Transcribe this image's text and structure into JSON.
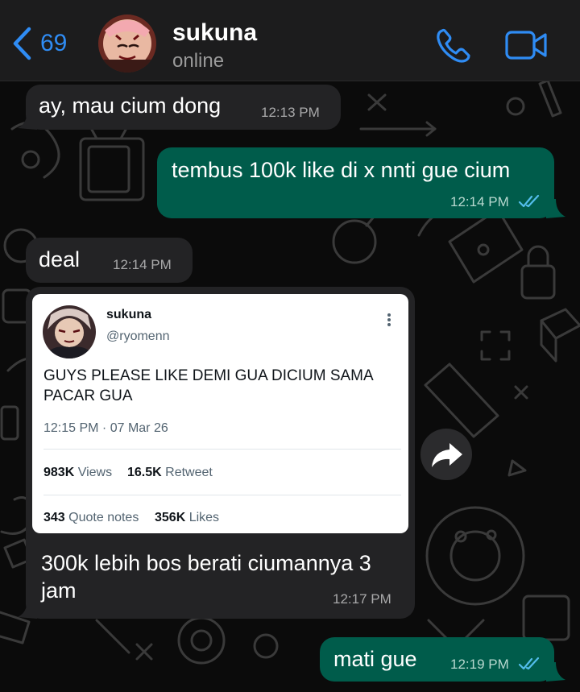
{
  "header": {
    "back_count": "69",
    "contact_name": "sukuna",
    "status": "online",
    "colors": {
      "accent": "#2f8cf4",
      "header_bg": "#1c1c1d"
    },
    "icons": [
      "chevron-left-icon",
      "phone-icon",
      "video-camera-icon"
    ]
  },
  "messages": [
    {
      "direction": "incoming",
      "text": "ay, mau cium dong",
      "time": "12:13 PM"
    },
    {
      "direction": "outgoing",
      "text": "tembus 100k like di x nnti gue cium",
      "time": "12:14 PM",
      "status": "read"
    },
    {
      "direction": "incoming",
      "text": "deal",
      "time": "12:14 PM"
    },
    {
      "direction": "incoming",
      "caption": [
        "300k lebih bos berati ciumannya 3",
        "jam"
      ],
      "time": "12:17 PM",
      "tweet": {
        "name": "sukuna",
        "handle": "@ryomenn",
        "text": "GUYS PLEASE LIKE DEMI GUA DICIUM SAMA PACAR GUA",
        "timestamp": "12:15 PM · 07 Mar 26",
        "views_count": "983K",
        "views_label": "Views",
        "retweet_count": "16.5K",
        "retweet_label": "Retweet",
        "quote_count": "343",
        "quote_label": "Quote notes",
        "likes_count": "356K",
        "likes_label": "Likes"
      }
    },
    {
      "direction": "outgoing",
      "text": "mati gue",
      "time": "12:19 PM",
      "status": "read"
    }
  ],
  "colors": {
    "incoming_bubble": "#232325",
    "outgoing_bubble": "#005c4b",
    "read_ticks": "#53bdeb",
    "background": "#0b0b0b"
  }
}
